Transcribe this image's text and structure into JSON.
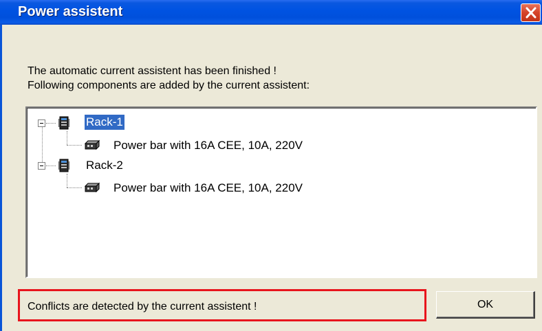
{
  "window": {
    "title": "Power assistent"
  },
  "message": {
    "line1": "The automatic current assistent has been finished !",
    "line2": "Following components are added by the current assistent:"
  },
  "tree": {
    "nodes": [
      {
        "label": "Rack-1",
        "icon": "rack-icon",
        "selected": true,
        "children": [
          {
            "label": "Power bar with 16A CEE, 10A, 220V",
            "icon": "power-bar-icon"
          }
        ]
      },
      {
        "label": "Rack-2",
        "icon": "rack-icon",
        "selected": false,
        "children": [
          {
            "label": "Power bar with 16A CEE, 10A, 220V",
            "icon": "power-bar-icon"
          }
        ]
      }
    ]
  },
  "status": {
    "text": "Conflicts are detected by the current assistent !"
  },
  "buttons": {
    "ok_label": "OK",
    "close_icon": "close-icon"
  },
  "colors": {
    "titlebar": "#0053e2",
    "selection": "#316ac5",
    "highlight_border": "#e8141c",
    "close_button": "#d5432a"
  }
}
